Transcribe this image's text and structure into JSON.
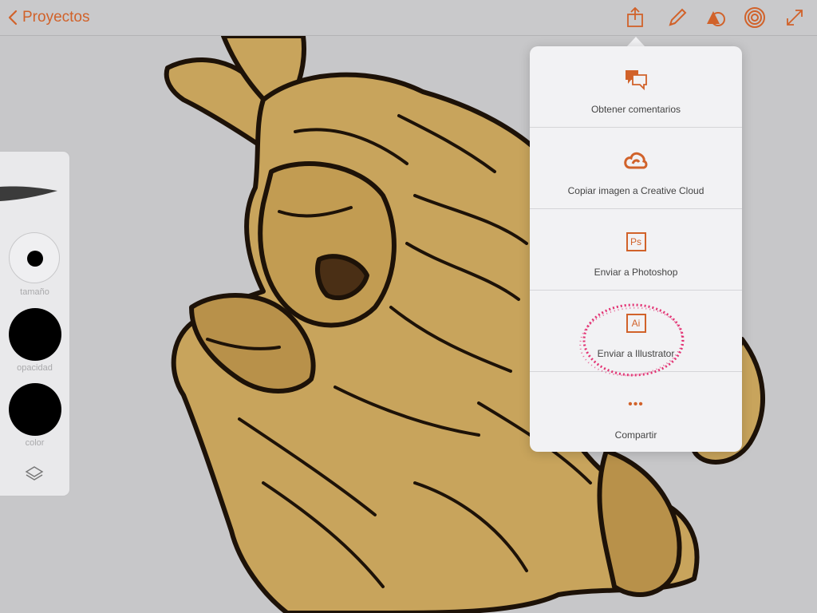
{
  "toolbar": {
    "back_label": "Proyectos",
    "accent_color": "#d1622a",
    "icons": [
      "share-icon",
      "pencil-icon",
      "shapes-icon",
      "radial-icon",
      "expand-icon"
    ]
  },
  "tool_panel": {
    "size_label": "tamaño",
    "opacity_label": "opacidad",
    "color_label": "color",
    "layers_icon": "layers-icon"
  },
  "share_menu": {
    "items": [
      {
        "label": "Obtener comentarios",
        "icon": "comments-icon"
      },
      {
        "label": "Copiar imagen a Creative Cloud",
        "icon": "creative-cloud-icon"
      },
      {
        "label": "Enviar a Photoshop",
        "icon": "photoshop-icon",
        "icon_text": "Ps"
      },
      {
        "label": "Enviar a Illustrator",
        "icon": "illustrator-icon",
        "icon_text": "Ai"
      },
      {
        "label": "Compartir",
        "icon": "more-icon",
        "icon_text": "•••"
      }
    ]
  }
}
